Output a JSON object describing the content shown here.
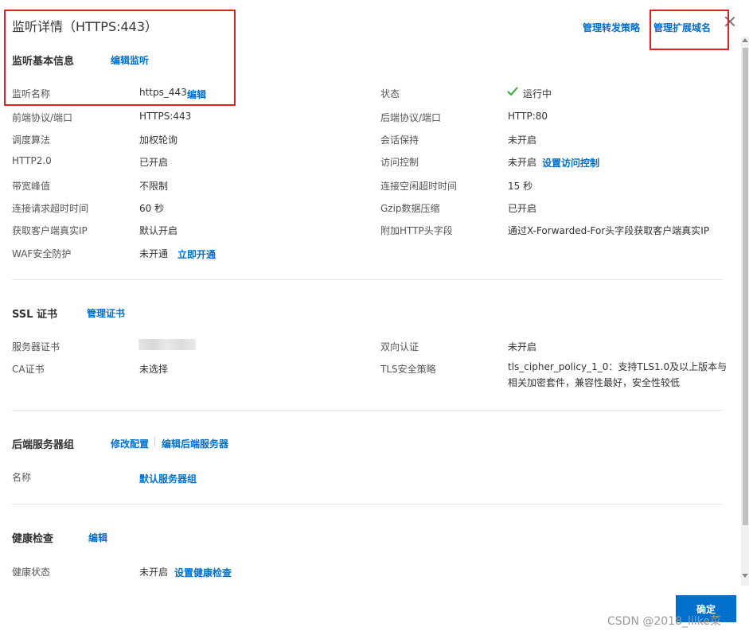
{
  "header": {
    "title": "监听详情（HTTPS:443）",
    "manage_forward": "管理转发策略",
    "manage_domain": "管理扩展域名"
  },
  "basic": {
    "title": "监听基本信息",
    "edit_link": "编辑监听",
    "rows_left": [
      {
        "label": "监听名称",
        "value": "https_443"
      },
      {
        "label": "前端协议/端口",
        "value": "HTTPS:443"
      },
      {
        "label": "调度算法",
        "value": "加权轮询"
      },
      {
        "label": "HTTP2.0",
        "value": "已开启"
      },
      {
        "label": "带宽峰值",
        "value": "不限制"
      },
      {
        "label": "连接请求超时时间",
        "value": "60 秒"
      },
      {
        "label": "获取客户端真实IP",
        "value": "默认开启"
      },
      {
        "label": "WAF安全防护",
        "value": "未开通"
      }
    ],
    "rows_right": [
      {
        "label": "状态",
        "value": "运行中"
      },
      {
        "label": "后端协议/端口",
        "value": "HTTP:80"
      },
      {
        "label": "会话保持",
        "value": "未开启"
      },
      {
        "label": "访问控制",
        "value": "未开启"
      },
      {
        "label": "连接空闲超时时间",
        "value": "15 秒"
      },
      {
        "label": "Gzip数据压缩",
        "value": "已开启"
      },
      {
        "label": "附加HTTP头字段",
        "value": "通过X-Forwarded-For头字段获取客户端真实IP"
      }
    ],
    "name_edit": "编辑",
    "acl_link": "设置访问控制",
    "waf_link": "立即开通"
  },
  "ssl": {
    "title": "SSL 证书",
    "manage_link": "管理证书",
    "server_cert_label": "服务器证书",
    "ca_label": "CA证书",
    "ca_value": "未选择",
    "mutual_label": "双向认证",
    "mutual_value": "未开启",
    "tls_label": "TLS安全策略",
    "tls_value": "tls_cipher_policy_1_0：支持TLS1.0及以上版本与相关加密套件，兼容性最好，安全性较低"
  },
  "backend": {
    "title": "后端服务器组",
    "modify_link": "修改配置",
    "edit_link": "编辑后端服务器",
    "name_label": "名称",
    "name_value": "默认服务器组"
  },
  "health": {
    "title": "健康检查",
    "edit_link": "编辑",
    "status_label": "健康状态",
    "status_value": "未开启",
    "set_link": "设置健康检查"
  },
  "footer": {
    "ok_label": "确定",
    "watermark": "CSDN @2018_lilke菜"
  },
  "colors": {
    "link": "#0070cc",
    "highlight_box": "#e02020",
    "running_check": "#2eaa3b"
  }
}
